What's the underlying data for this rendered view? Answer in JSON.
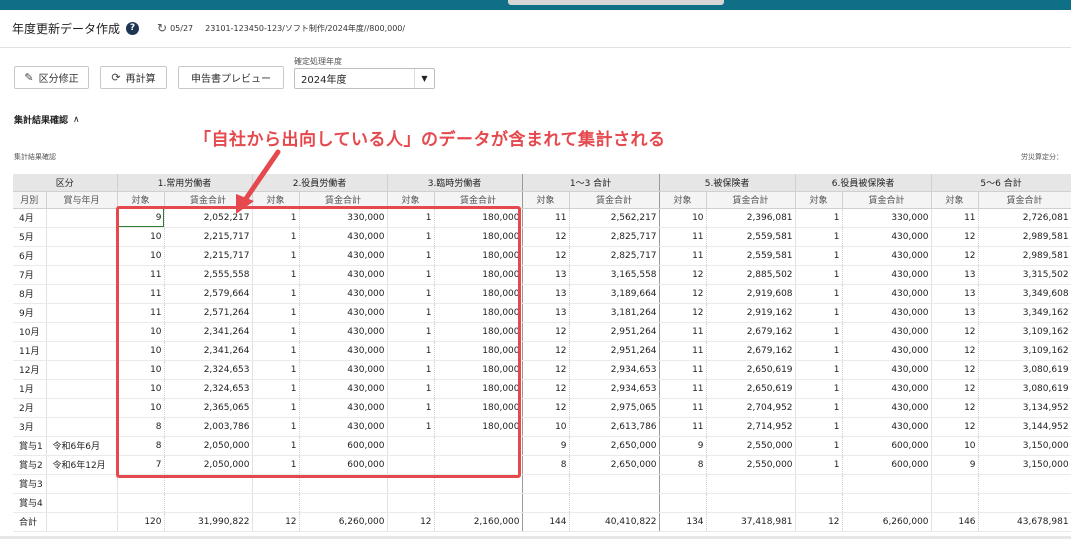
{
  "header": {
    "title": "年度更新データ作成",
    "help_icon": "?",
    "history_icon": "↻",
    "history_date": "05/27",
    "breadcrumb": "23101-123450-123/ソフト制作/2024年度//800,000/"
  },
  "toolbar": {
    "kubun_label": "区分修正",
    "kubun_icon": "✎",
    "recalc_label": "再計算",
    "recalc_icon": "⟳",
    "preview_label": "申告書プレビュー",
    "year_label": "確定処理年度",
    "year_value": "2024年度",
    "year_arrow": "▼"
  },
  "section": {
    "title": "集計結果確認",
    "caret": "∧",
    "subtitle": "集計結果確認",
    "right_note": "労災算定分："
  },
  "callout": {
    "text": "「自社から出向している人」のデータが含まれて集計される",
    "color": "#e5484d"
  },
  "table": {
    "groups": [
      "区分",
      "1.常用労働者",
      "2.役員労働者",
      "3.臨時労働者",
      "1〜3 合計",
      "5.被保険者",
      "6.役員被保険者",
      "5〜6 合計"
    ],
    "sub_left": [
      "月別",
      "賞与年月"
    ],
    "sub_count": "対象",
    "sub_amount": "賃金合計",
    "rows": [
      {
        "m": "4月",
        "y": "",
        "v": [
          "9",
          "2,052,217",
          "1",
          "330,000",
          "1",
          "180,000",
          "11",
          "2,562,217",
          "10",
          "2,396,081",
          "1",
          "330,000",
          "11",
          "2,726,081"
        ]
      },
      {
        "m": "5月",
        "y": "",
        "v": [
          "10",
          "2,215,717",
          "1",
          "430,000",
          "1",
          "180,000",
          "12",
          "2,825,717",
          "11",
          "2,559,581",
          "1",
          "430,000",
          "12",
          "2,989,581"
        ]
      },
      {
        "m": "6月",
        "y": "",
        "v": [
          "10",
          "2,215,717",
          "1",
          "430,000",
          "1",
          "180,000",
          "12",
          "2,825,717",
          "11",
          "2,559,581",
          "1",
          "430,000",
          "12",
          "2,989,581"
        ]
      },
      {
        "m": "7月",
        "y": "",
        "v": [
          "11",
          "2,555,558",
          "1",
          "430,000",
          "1",
          "180,000",
          "13",
          "3,165,558",
          "12",
          "2,885,502",
          "1",
          "430,000",
          "13",
          "3,315,502"
        ]
      },
      {
        "m": "8月",
        "y": "",
        "v": [
          "11",
          "2,579,664",
          "1",
          "430,000",
          "1",
          "180,000",
          "13",
          "3,189,664",
          "12",
          "2,919,608",
          "1",
          "430,000",
          "13",
          "3,349,608"
        ]
      },
      {
        "m": "9月",
        "y": "",
        "v": [
          "11",
          "2,571,264",
          "1",
          "430,000",
          "1",
          "180,000",
          "13",
          "3,181,264",
          "12",
          "2,919,162",
          "1",
          "430,000",
          "13",
          "3,349,162"
        ]
      },
      {
        "m": "10月",
        "y": "",
        "v": [
          "10",
          "2,341,264",
          "1",
          "430,000",
          "1",
          "180,000",
          "12",
          "2,951,264",
          "11",
          "2,679,162",
          "1",
          "430,000",
          "12",
          "3,109,162"
        ]
      },
      {
        "m": "11月",
        "y": "",
        "v": [
          "10",
          "2,341,264",
          "1",
          "430,000",
          "1",
          "180,000",
          "12",
          "2,951,264",
          "11",
          "2,679,162",
          "1",
          "430,000",
          "12",
          "3,109,162"
        ]
      },
      {
        "m": "12月",
        "y": "",
        "v": [
          "10",
          "2,324,653",
          "1",
          "430,000",
          "1",
          "180,000",
          "12",
          "2,934,653",
          "11",
          "2,650,619",
          "1",
          "430,000",
          "12",
          "3,080,619"
        ]
      },
      {
        "m": "1月",
        "y": "",
        "v": [
          "10",
          "2,324,653",
          "1",
          "430,000",
          "1",
          "180,000",
          "12",
          "2,934,653",
          "11",
          "2,650,619",
          "1",
          "430,000",
          "12",
          "3,080,619"
        ]
      },
      {
        "m": "2月",
        "y": "",
        "v": [
          "10",
          "2,365,065",
          "1",
          "430,000",
          "1",
          "180,000",
          "12",
          "2,975,065",
          "11",
          "2,704,952",
          "1",
          "430,000",
          "12",
          "3,134,952"
        ]
      },
      {
        "m": "3月",
        "y": "",
        "v": [
          "8",
          "2,003,786",
          "1",
          "430,000",
          "1",
          "180,000",
          "10",
          "2,613,786",
          "11",
          "2,714,952",
          "1",
          "430,000",
          "12",
          "3,144,952"
        ]
      },
      {
        "m": "賞与1",
        "y": "令和6年6月",
        "v": [
          "8",
          "2,050,000",
          "1",
          "600,000",
          "",
          "",
          "9",
          "2,650,000",
          "9",
          "2,550,000",
          "1",
          "600,000",
          "10",
          "3,150,000"
        ]
      },
      {
        "m": "賞与2",
        "y": "令和6年12月",
        "v": [
          "7",
          "2,050,000",
          "1",
          "600,000",
          "",
          "",
          "8",
          "2,650,000",
          "8",
          "2,550,000",
          "1",
          "600,000",
          "9",
          "3,150,000"
        ]
      },
      {
        "m": "賞与3",
        "y": "",
        "v": [
          "",
          "",
          "",
          "",
          "",
          "",
          "",
          "",
          "",
          "",
          "",
          "",
          "",
          ""
        ]
      },
      {
        "m": "賞与4",
        "y": "",
        "v": [
          "",
          "",
          "",
          "",
          "",
          "",
          "",
          "",
          "",
          "",
          "",
          "",
          "",
          ""
        ]
      }
    ],
    "total": {
      "m": "合計",
      "y": "",
      "v": [
        "120",
        "31,990,822",
        "12",
        "6,260,000",
        "12",
        "2,160,000",
        "144",
        "40,410,822",
        "134",
        "37,418,981",
        "12",
        "6,260,000",
        "146",
        "43,678,981"
      ]
    }
  }
}
